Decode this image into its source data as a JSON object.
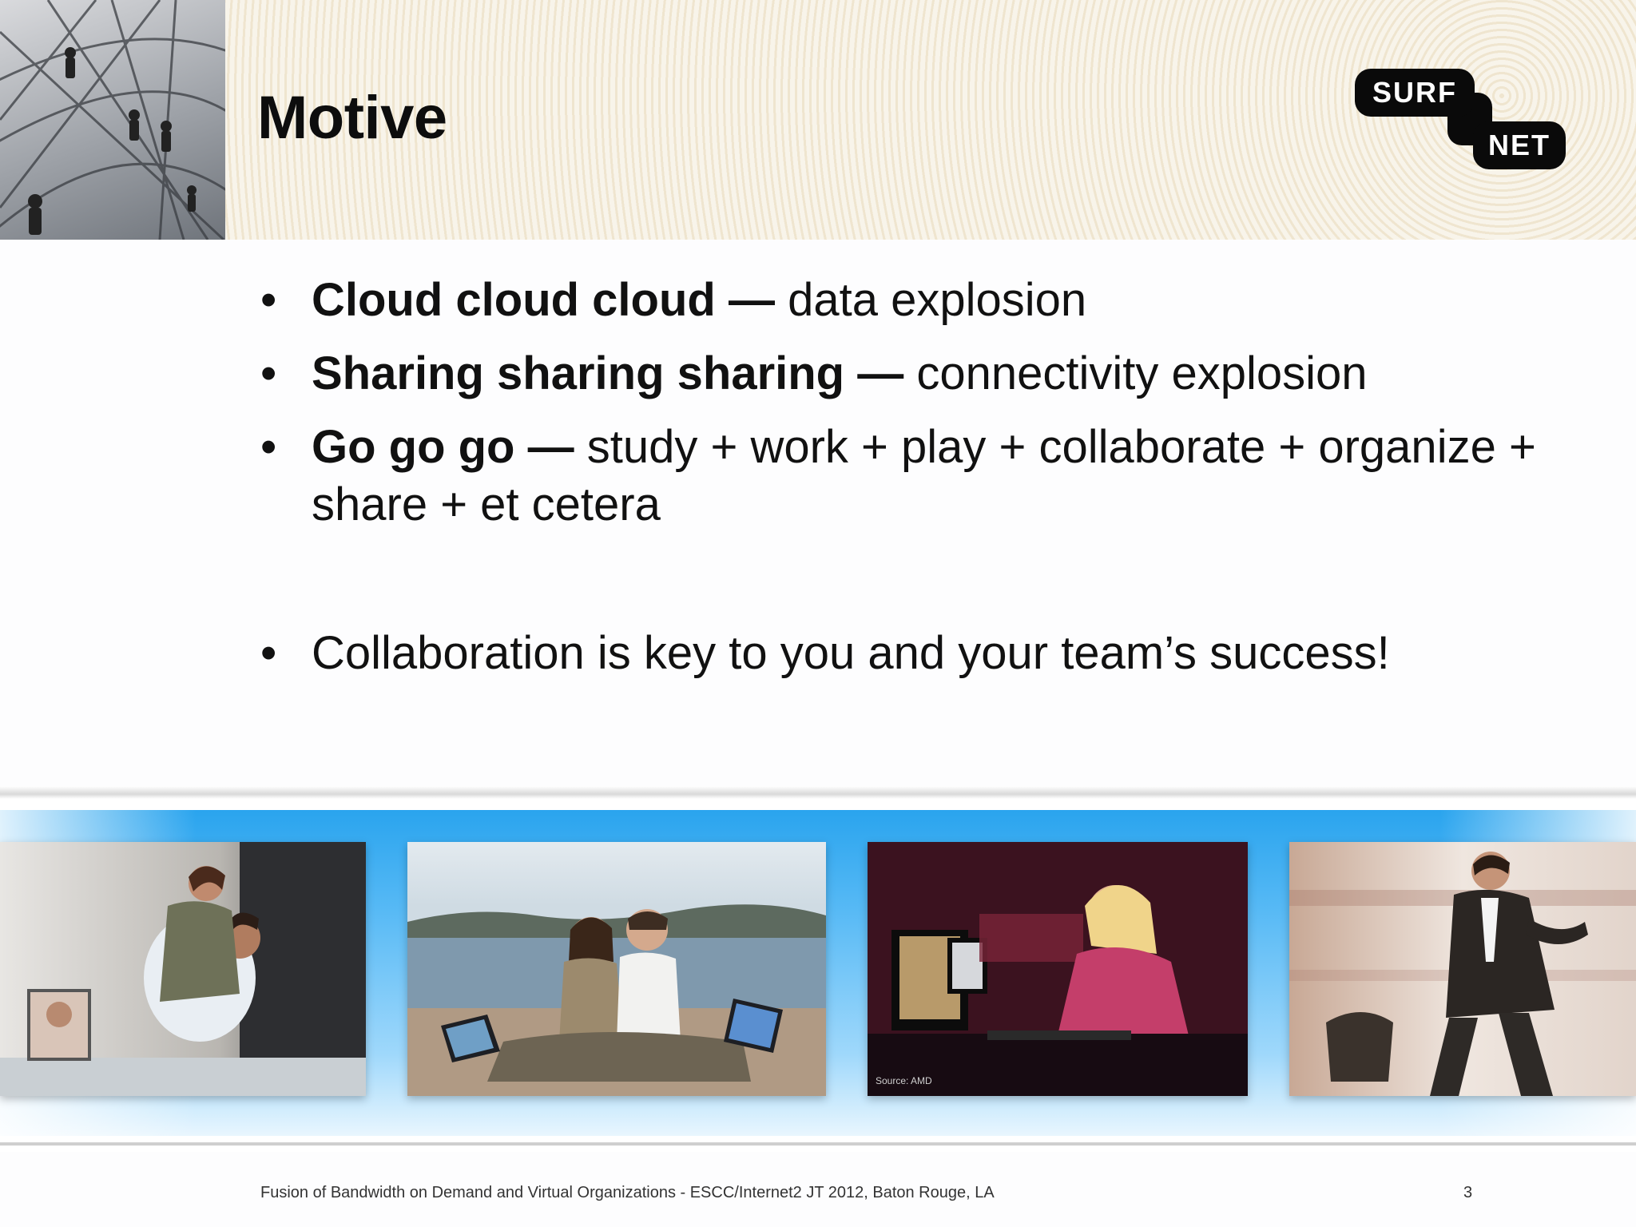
{
  "slide": {
    "title": "Motive",
    "logo": {
      "line1": "SURF",
      "line2": "NET"
    }
  },
  "bullets": [
    {
      "lead": "Cloud cloud cloud —",
      "rest": " data explosion"
    },
    {
      "lead": "Sharing sharing sharing —",
      "rest": " connectivity explosion"
    },
    {
      "lead": "Go go go —",
      "rest": " study + work + play + collaborate + organize + share + et cetera"
    },
    {
      "lead": "",
      "rest": "Collaboration is key to you and your team’s success!"
    }
  ],
  "bullet_glyph": "•",
  "photo_strip": {
    "photos": [
      {
        "subject": "office video call"
      },
      {
        "subject": "laptops on beach"
      },
      {
        "subject": "gaming"
      },
      {
        "subject": "businessman walking"
      }
    ],
    "caption": "Source: AMD"
  },
  "footer": {
    "text": "Fusion of Bandwidth on Demand and Virtual Organizations - ESCC/Internet2 JT 2012, Baton Rouge, LA",
    "page_number": "3"
  },
  "colors": {
    "strip_blue": "#2aa4ee",
    "header_beige": "#f4efe3",
    "logo_black": "#0a0a0a"
  }
}
